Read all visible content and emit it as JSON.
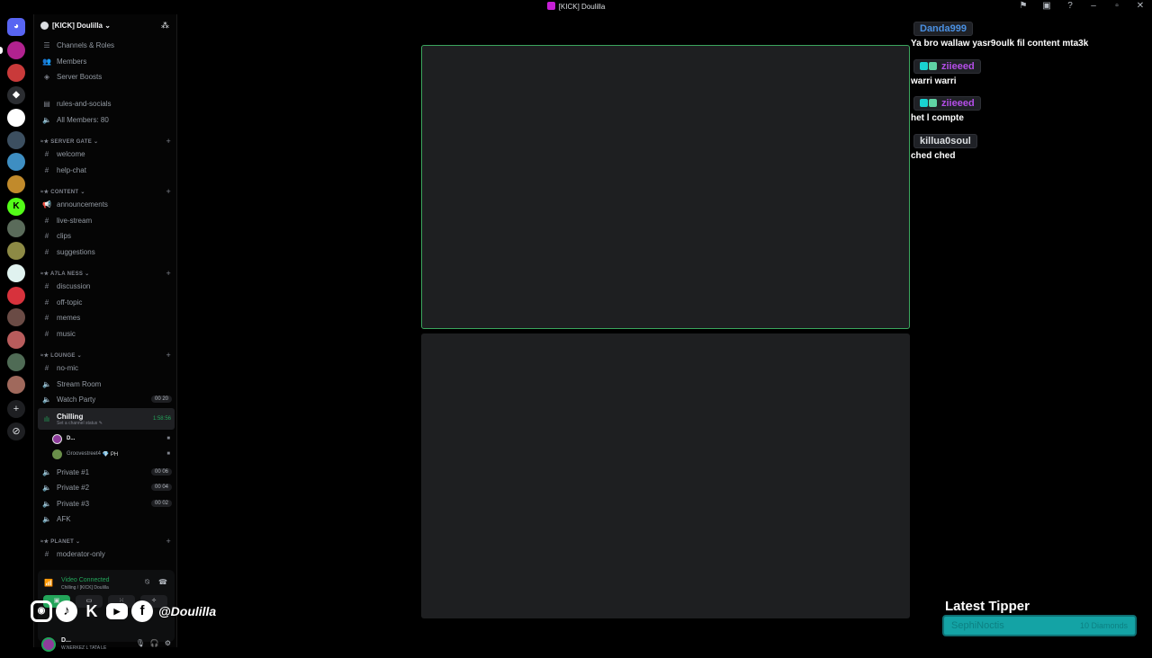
{
  "window": {
    "title": "[KICK] Doulilla",
    "icons": [
      "flag-icon",
      "inbox-icon",
      "help-icon",
      "minimize-icon",
      "maximize-icon",
      "close-icon"
    ]
  },
  "server_rail": {
    "servers": [
      {
        "color": "#5865f2",
        "symbol": "discord"
      },
      {
        "color": "#b1228f"
      },
      {
        "color": "#c93a3a"
      },
      {
        "color": "#2b2d31",
        "symbol": "◆"
      },
      {
        "color": "#ffffff"
      },
      {
        "color": "#3c4f60"
      },
      {
        "color": "#3e8ec2"
      },
      {
        "color": "#c18a2b"
      },
      {
        "color": "#53fc18",
        "symbol": "K"
      },
      {
        "color": "#5a6b5a"
      },
      {
        "color": "#8d8a45"
      },
      {
        "color": "#e0f2ef"
      },
      {
        "color": "#d7323c"
      },
      {
        "color": "#6a4b45"
      },
      {
        "color": "#b85c5c"
      },
      {
        "color": "#4f6b55"
      },
      {
        "color": "#a0695c"
      }
    ],
    "add_server_symbol": "+",
    "discover_symbol": "⊘"
  },
  "sidebar": {
    "guild_name": "[KICK] Doulilla",
    "guild_chevron": "⌄",
    "top_items": [
      {
        "label": "Channels & Roles",
        "icon": "list-icon"
      },
      {
        "label": "Members",
        "icon": "members-icon"
      },
      {
        "label": "Server Boosts",
        "icon": "boost-icon"
      },
      {
        "label": "rules-and-socials",
        "icon": "rules-icon"
      },
      {
        "label": "All Members: 80",
        "icon": "member-count-icon"
      }
    ],
    "categories": [
      {
        "name": "SERVER GATE",
        "channels": [
          {
            "label": "welcome"
          },
          {
            "label": "help-chat"
          }
        ]
      },
      {
        "name": "CONTENT",
        "channels": [
          {
            "label": "announcements",
            "icon": "megaphone"
          },
          {
            "label": "live-stream"
          },
          {
            "label": "clips"
          },
          {
            "label": "suggestions"
          }
        ]
      },
      {
        "name": "A7LA NESS",
        "channels": [
          {
            "label": "discussion"
          },
          {
            "label": "off-topic"
          },
          {
            "label": "memes"
          },
          {
            "label": "music"
          }
        ]
      },
      {
        "name": "LOUNGE",
        "channels": [
          {
            "label": "no-mic"
          },
          {
            "label": "Stream Room",
            "voice": true
          },
          {
            "label": "Watch Party",
            "voice": true,
            "badge": "00 20"
          }
        ]
      }
    ],
    "active_voice": {
      "label": "Chilling",
      "status": "Set a channel status",
      "timer": "1:58:56",
      "users": [
        {
          "name": "D...",
          "color": "#8e3c9b"
        },
        {
          "name": "Groovestreet4",
          "tag": "PH",
          "color": "#6a8f4a"
        }
      ]
    },
    "more_voice": [
      {
        "label": "Private #1",
        "badge": "00 06"
      },
      {
        "label": "Private #2",
        "badge": "00 04"
      },
      {
        "label": "Private #3",
        "badge": "00 02"
      },
      {
        "label": "AFK"
      }
    ],
    "planet": {
      "name": "PLANET",
      "channels": [
        {
          "label": "moderator-only"
        }
      ]
    }
  },
  "voice_panel": {
    "title": "Video Connected",
    "subtitle": "Chilling / [KICK] Doulilla",
    "buttons": [
      "▣",
      "▭",
      "⁙",
      "✧"
    ]
  },
  "user_panel": {
    "name": "D...",
    "status": "W.NERKEZ L TATA LE"
  },
  "overlay": {
    "social_handle": "@Doulilla",
    "social_icons": [
      "instagram-icon",
      "tiktok-icon",
      "kick-icon",
      "youtube-icon",
      "facebook-icon"
    ],
    "chat": [
      {
        "user": "Danda999",
        "color": "#4a90e2",
        "badges": false,
        "text": "Ya bro wallaw yasr9oulk fil content mta3k"
      },
      {
        "user": "ziieeed",
        "color": "#b44ee8",
        "badges": true,
        "text": "warri warri"
      },
      {
        "user": "ziieeed",
        "color": "#b44ee8",
        "badges": true,
        "text": "het l compte"
      },
      {
        "user": "killua0soul",
        "color": "#dbdee1",
        "badges": false,
        "text": "ched ched"
      }
    ],
    "latest_tipper": {
      "title": "Latest Tipper",
      "name": "SephiNoctis",
      "amount": "10 Diamonds"
    }
  }
}
